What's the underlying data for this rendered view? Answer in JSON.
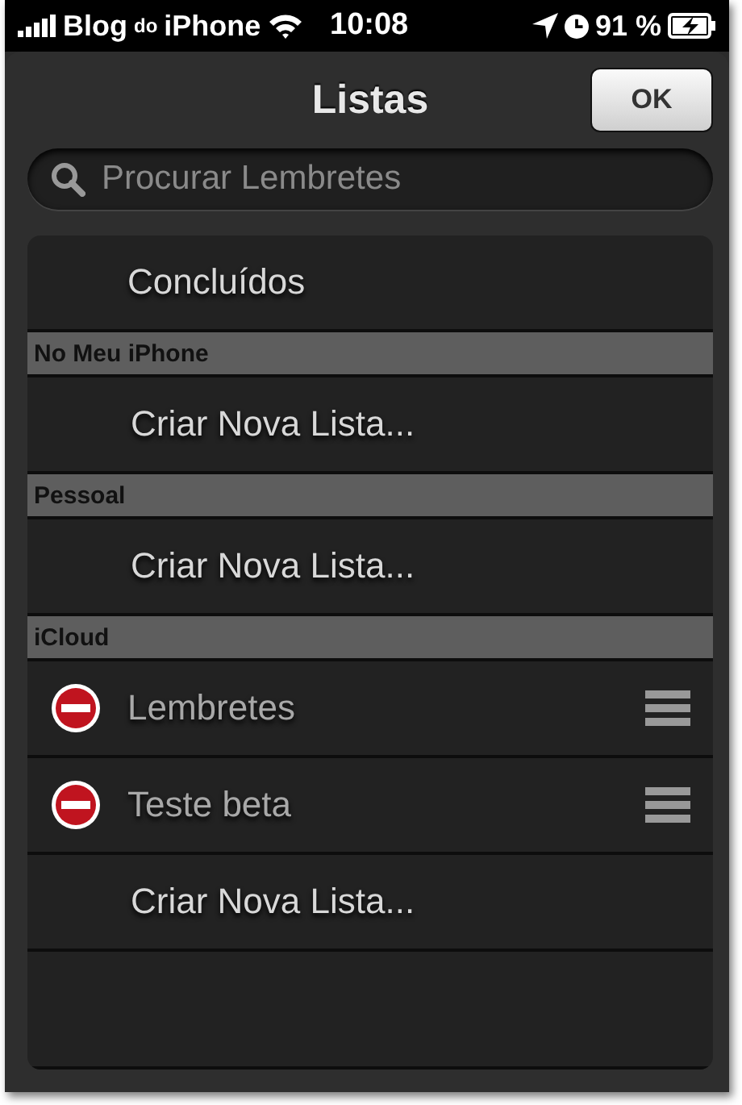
{
  "status_bar": {
    "carrier": [
      "Blog",
      "do",
      "iPhone"
    ],
    "time": "10:08",
    "battery": "91 %"
  },
  "header": {
    "title": "Listas",
    "button": "OK"
  },
  "search": {
    "placeholder": "Procurar Lembretes"
  },
  "items": [
    {
      "kind": "plain",
      "label": "Concluídos"
    },
    {
      "kind": "header",
      "label": "No Meu iPhone"
    },
    {
      "kind": "action",
      "label": "Criar Nova Lista..."
    },
    {
      "kind": "header",
      "label": "Pessoal"
    },
    {
      "kind": "action",
      "label": "Criar Nova Lista..."
    },
    {
      "kind": "header",
      "label": "iCloud"
    },
    {
      "kind": "list",
      "label": "Lembretes"
    },
    {
      "kind": "list",
      "label": "Teste beta"
    },
    {
      "kind": "action",
      "label": "Criar Nova Lista..."
    }
  ]
}
